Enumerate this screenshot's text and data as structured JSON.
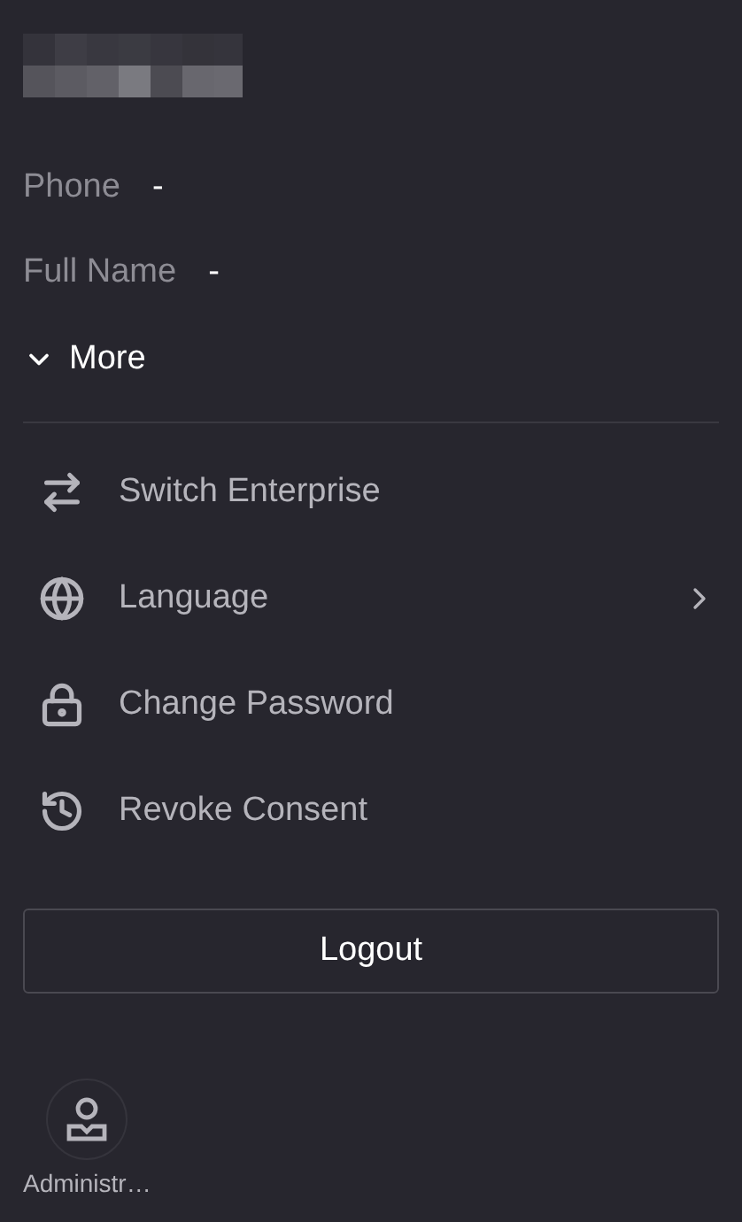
{
  "fields": [
    {
      "label": "Phone",
      "value": "-"
    },
    {
      "label": "Full Name",
      "value": "-"
    }
  ],
  "more": {
    "label": "More",
    "expanded": false
  },
  "menu": [
    {
      "kind": "switch",
      "label": "Switch Enterprise",
      "submenu": false
    },
    {
      "kind": "globe",
      "label": "Language",
      "submenu": true
    },
    {
      "kind": "lock",
      "label": "Change Password",
      "submenu": false
    },
    {
      "kind": "history",
      "label": "Revoke Consent",
      "submenu": false
    }
  ],
  "logout": "Logout",
  "role": {
    "label": "Administr…"
  }
}
